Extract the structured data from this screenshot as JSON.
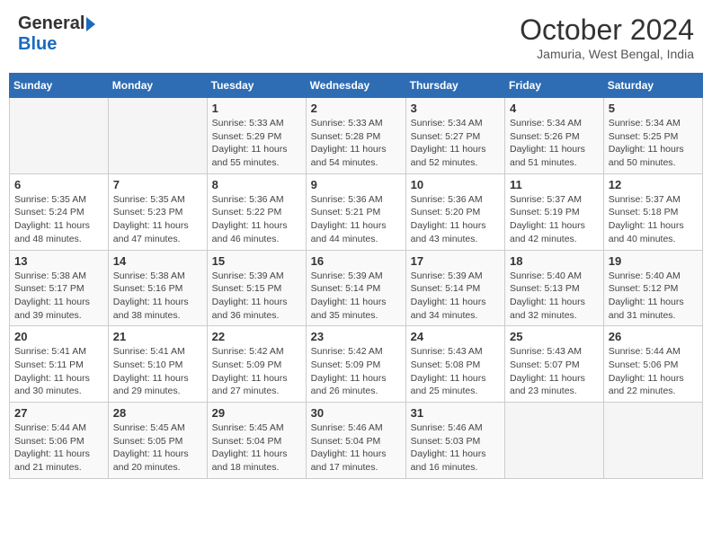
{
  "header": {
    "logo_general": "General",
    "logo_blue": "Blue",
    "month_title": "October 2024",
    "location": "Jamuria, West Bengal, India"
  },
  "calendar": {
    "days_of_week": [
      "Sunday",
      "Monday",
      "Tuesday",
      "Wednesday",
      "Thursday",
      "Friday",
      "Saturday"
    ],
    "weeks": [
      [
        {
          "day": "",
          "info": ""
        },
        {
          "day": "",
          "info": ""
        },
        {
          "day": "1",
          "info": "Sunrise: 5:33 AM\nSunset: 5:29 PM\nDaylight: 11 hours and 55 minutes."
        },
        {
          "day": "2",
          "info": "Sunrise: 5:33 AM\nSunset: 5:28 PM\nDaylight: 11 hours and 54 minutes."
        },
        {
          "day": "3",
          "info": "Sunrise: 5:34 AM\nSunset: 5:27 PM\nDaylight: 11 hours and 52 minutes."
        },
        {
          "day": "4",
          "info": "Sunrise: 5:34 AM\nSunset: 5:26 PM\nDaylight: 11 hours and 51 minutes."
        },
        {
          "day": "5",
          "info": "Sunrise: 5:34 AM\nSunset: 5:25 PM\nDaylight: 11 hours and 50 minutes."
        }
      ],
      [
        {
          "day": "6",
          "info": "Sunrise: 5:35 AM\nSunset: 5:24 PM\nDaylight: 11 hours and 48 minutes."
        },
        {
          "day": "7",
          "info": "Sunrise: 5:35 AM\nSunset: 5:23 PM\nDaylight: 11 hours and 47 minutes."
        },
        {
          "day": "8",
          "info": "Sunrise: 5:36 AM\nSunset: 5:22 PM\nDaylight: 11 hours and 46 minutes."
        },
        {
          "day": "9",
          "info": "Sunrise: 5:36 AM\nSunset: 5:21 PM\nDaylight: 11 hours and 44 minutes."
        },
        {
          "day": "10",
          "info": "Sunrise: 5:36 AM\nSunset: 5:20 PM\nDaylight: 11 hours and 43 minutes."
        },
        {
          "day": "11",
          "info": "Sunrise: 5:37 AM\nSunset: 5:19 PM\nDaylight: 11 hours and 42 minutes."
        },
        {
          "day": "12",
          "info": "Sunrise: 5:37 AM\nSunset: 5:18 PM\nDaylight: 11 hours and 40 minutes."
        }
      ],
      [
        {
          "day": "13",
          "info": "Sunrise: 5:38 AM\nSunset: 5:17 PM\nDaylight: 11 hours and 39 minutes."
        },
        {
          "day": "14",
          "info": "Sunrise: 5:38 AM\nSunset: 5:16 PM\nDaylight: 11 hours and 38 minutes."
        },
        {
          "day": "15",
          "info": "Sunrise: 5:39 AM\nSunset: 5:15 PM\nDaylight: 11 hours and 36 minutes."
        },
        {
          "day": "16",
          "info": "Sunrise: 5:39 AM\nSunset: 5:14 PM\nDaylight: 11 hours and 35 minutes."
        },
        {
          "day": "17",
          "info": "Sunrise: 5:39 AM\nSunset: 5:14 PM\nDaylight: 11 hours and 34 minutes."
        },
        {
          "day": "18",
          "info": "Sunrise: 5:40 AM\nSunset: 5:13 PM\nDaylight: 11 hours and 32 minutes."
        },
        {
          "day": "19",
          "info": "Sunrise: 5:40 AM\nSunset: 5:12 PM\nDaylight: 11 hours and 31 minutes."
        }
      ],
      [
        {
          "day": "20",
          "info": "Sunrise: 5:41 AM\nSunset: 5:11 PM\nDaylight: 11 hours and 30 minutes."
        },
        {
          "day": "21",
          "info": "Sunrise: 5:41 AM\nSunset: 5:10 PM\nDaylight: 11 hours and 29 minutes."
        },
        {
          "day": "22",
          "info": "Sunrise: 5:42 AM\nSunset: 5:09 PM\nDaylight: 11 hours and 27 minutes."
        },
        {
          "day": "23",
          "info": "Sunrise: 5:42 AM\nSunset: 5:09 PM\nDaylight: 11 hours and 26 minutes."
        },
        {
          "day": "24",
          "info": "Sunrise: 5:43 AM\nSunset: 5:08 PM\nDaylight: 11 hours and 25 minutes."
        },
        {
          "day": "25",
          "info": "Sunrise: 5:43 AM\nSunset: 5:07 PM\nDaylight: 11 hours and 23 minutes."
        },
        {
          "day": "26",
          "info": "Sunrise: 5:44 AM\nSunset: 5:06 PM\nDaylight: 11 hours and 22 minutes."
        }
      ],
      [
        {
          "day": "27",
          "info": "Sunrise: 5:44 AM\nSunset: 5:06 PM\nDaylight: 11 hours and 21 minutes."
        },
        {
          "day": "28",
          "info": "Sunrise: 5:45 AM\nSunset: 5:05 PM\nDaylight: 11 hours and 20 minutes."
        },
        {
          "day": "29",
          "info": "Sunrise: 5:45 AM\nSunset: 5:04 PM\nDaylight: 11 hours and 18 minutes."
        },
        {
          "day": "30",
          "info": "Sunrise: 5:46 AM\nSunset: 5:04 PM\nDaylight: 11 hours and 17 minutes."
        },
        {
          "day": "31",
          "info": "Sunrise: 5:46 AM\nSunset: 5:03 PM\nDaylight: 11 hours and 16 minutes."
        },
        {
          "day": "",
          "info": ""
        },
        {
          "day": "",
          "info": ""
        }
      ]
    ]
  }
}
